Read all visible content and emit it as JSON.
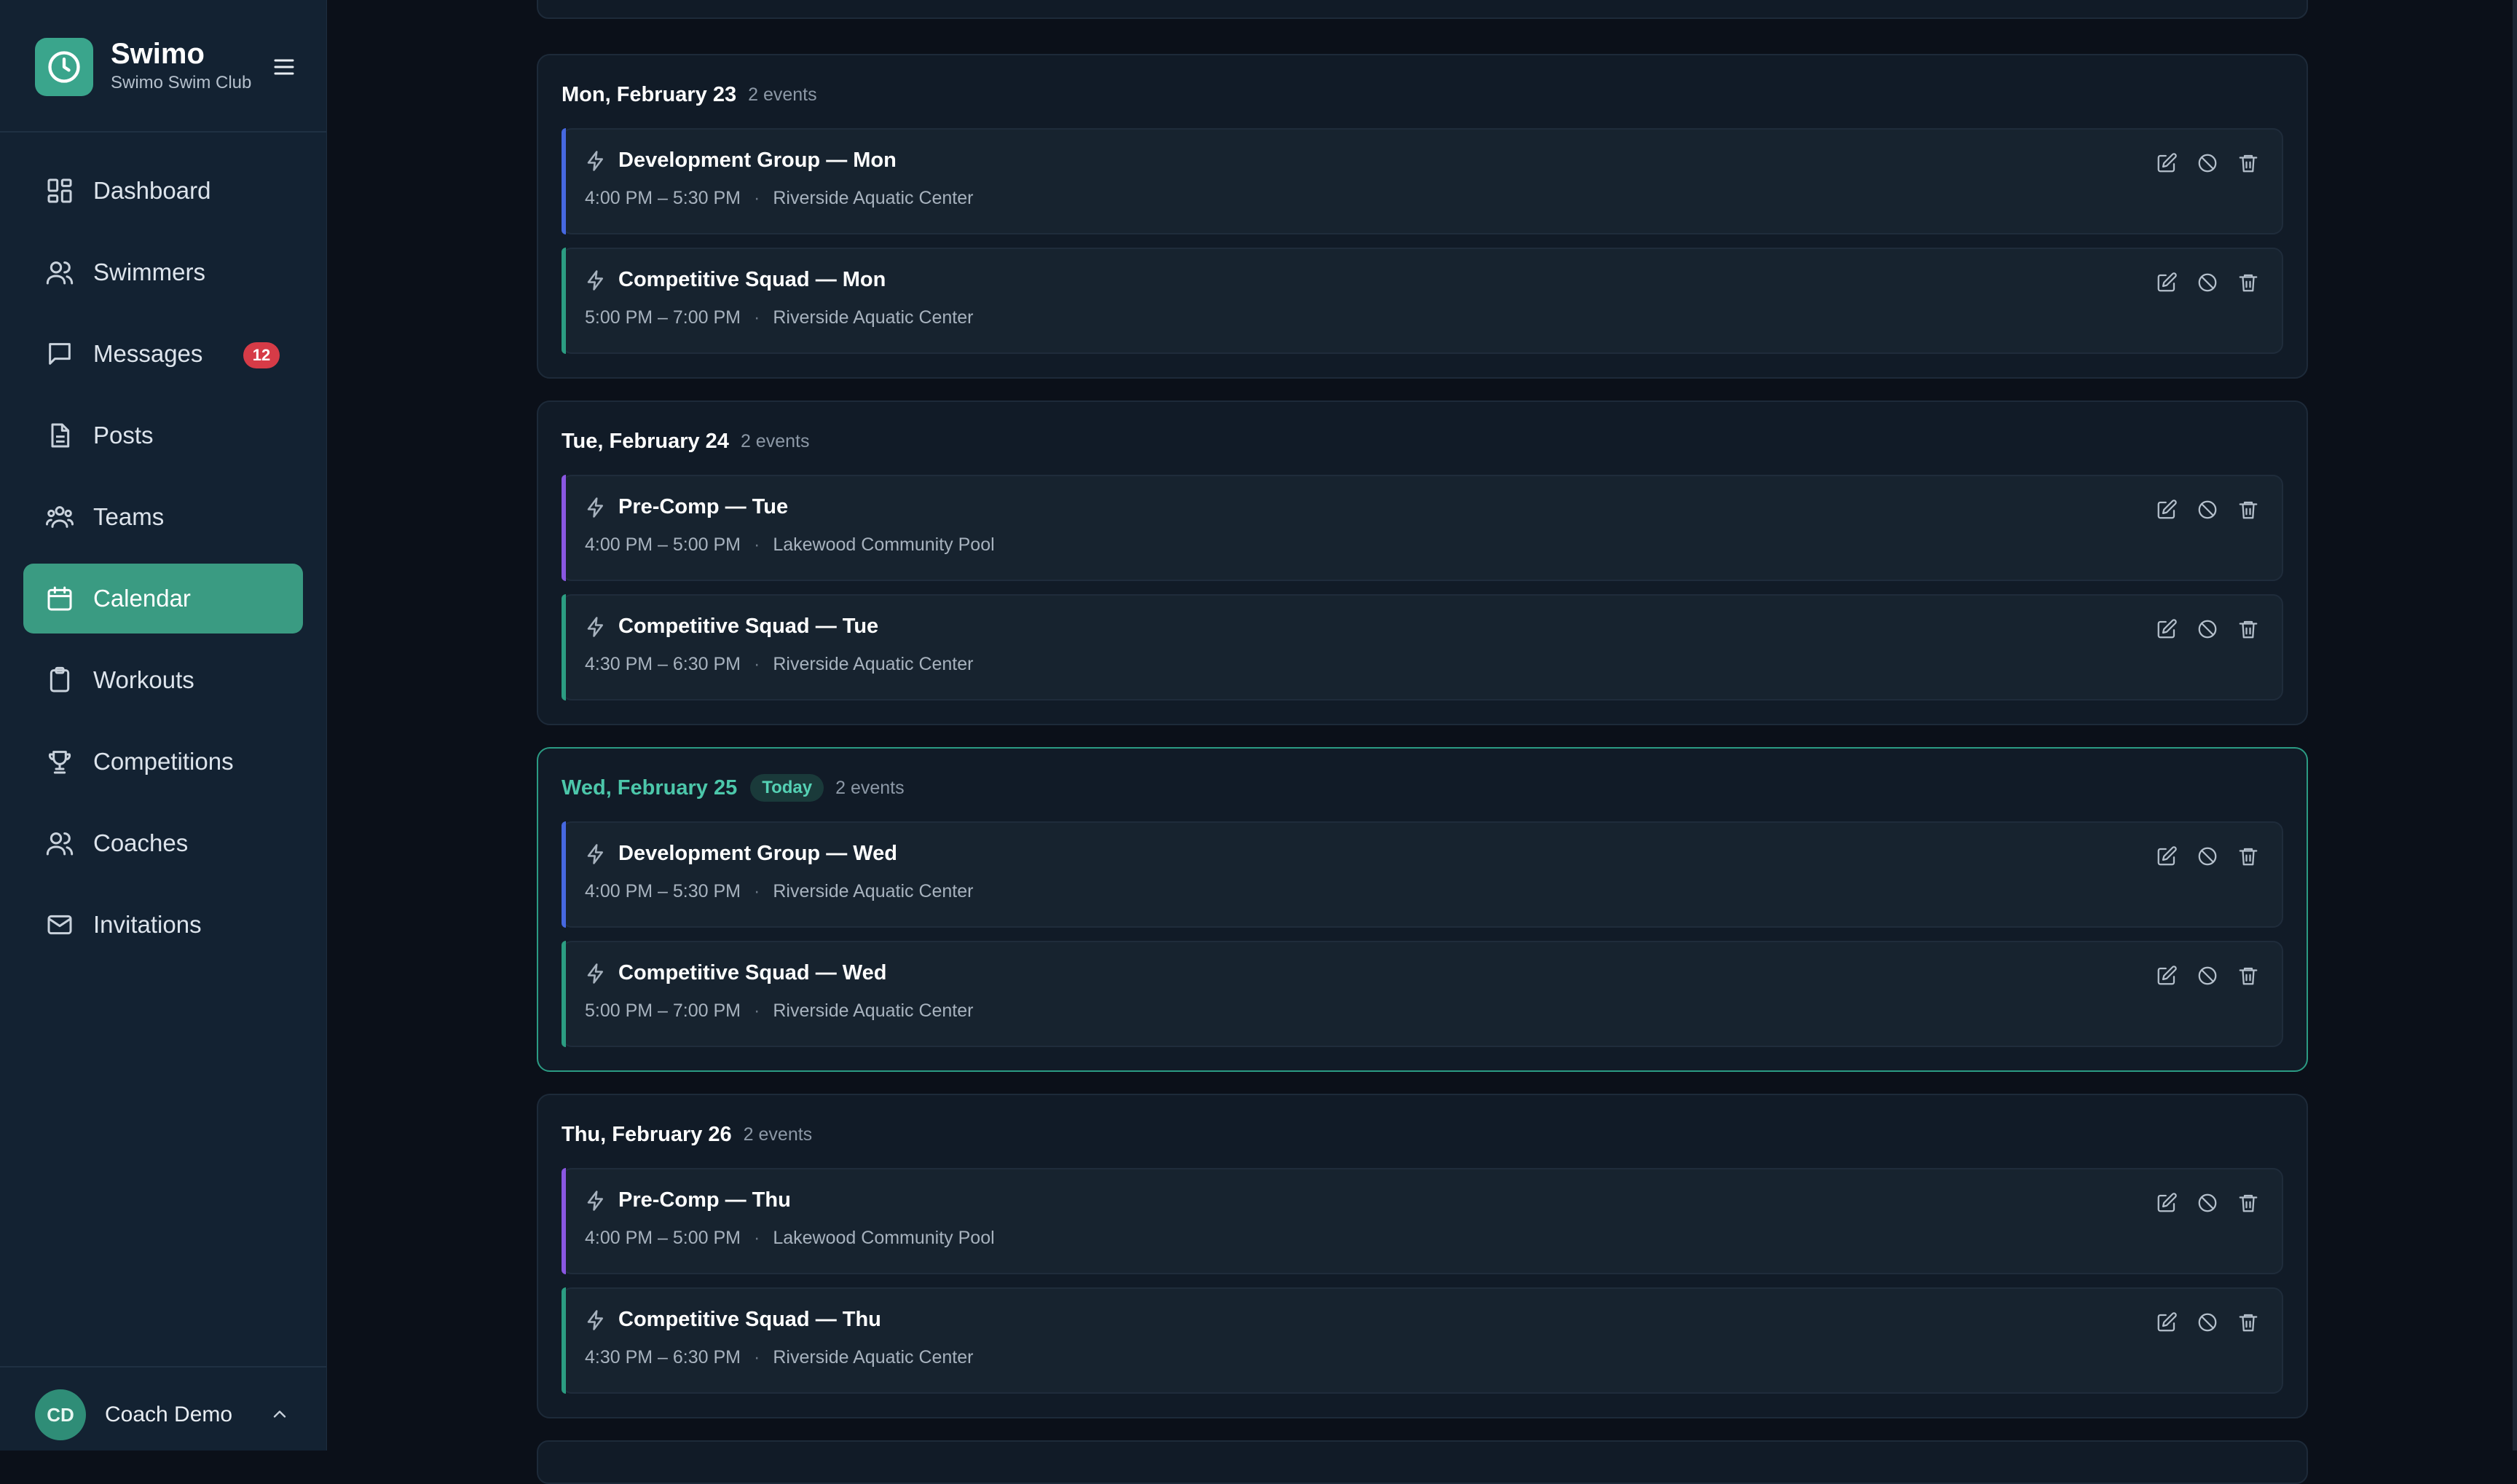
{
  "brand": {
    "title": "Swimo",
    "subtitle": "Swimo Swim Club",
    "logo_icon": "clock-icon",
    "accent": "#3aa58c"
  },
  "nav": [
    {
      "label": "Dashboard",
      "icon": "dashboard-icon",
      "active": false
    },
    {
      "label": "Swimmers",
      "icon": "users-icon",
      "active": false
    },
    {
      "label": "Messages",
      "icon": "message-icon",
      "active": false,
      "badge": "12"
    },
    {
      "label": "Posts",
      "icon": "document-icon",
      "active": false
    },
    {
      "label": "Teams",
      "icon": "team-icon",
      "active": false
    },
    {
      "label": "Calendar",
      "icon": "calendar-icon",
      "active": true
    },
    {
      "label": "Workouts",
      "icon": "clipboard-icon",
      "active": false
    },
    {
      "label": "Competitions",
      "icon": "trophy-icon",
      "active": false
    },
    {
      "label": "Coaches",
      "icon": "users-icon",
      "active": false
    },
    {
      "label": "Invitations",
      "icon": "mail-icon",
      "active": false
    }
  ],
  "user": {
    "initials": "CD",
    "name": "Coach Demo"
  },
  "days": [
    {
      "title": "Mon, February 23",
      "count": "2 events",
      "events": [
        {
          "title": "Development Group — Mon",
          "time": "4:00 PM – 5:30 PM",
          "location": "Riverside Aquatic Center",
          "color": "#4668e0"
        },
        {
          "title": "Competitive Squad — Mon",
          "time": "5:00 PM – 7:00 PM",
          "location": "Riverside Aquatic Center",
          "color": "#2c9d82"
        }
      ]
    },
    {
      "title": "Tue, February 24",
      "count": "2 events",
      "events": [
        {
          "title": "Pre-Comp — Tue",
          "time": "4:00 PM – 5:00 PM",
          "location": "Lakewood Community Pool",
          "color": "#8a57e2"
        },
        {
          "title": "Competitive Squad — Tue",
          "time": "4:30 PM – 6:30 PM",
          "location": "Riverside Aquatic Center",
          "color": "#2c9d82"
        }
      ]
    },
    {
      "title": "Wed, February 25",
      "today_label": "Today",
      "count": "2 events",
      "events": [
        {
          "title": "Development Group — Wed",
          "time": "4:00 PM – 5:30 PM",
          "location": "Riverside Aquatic Center",
          "color": "#4668e0"
        },
        {
          "title": "Competitive Squad — Wed",
          "time": "5:00 PM – 7:00 PM",
          "location": "Riverside Aquatic Center",
          "color": "#2c9d82"
        }
      ]
    },
    {
      "title": "Thu, February 26",
      "count": "2 events",
      "events": [
        {
          "title": "Pre-Comp — Thu",
          "time": "4:00 PM – 5:00 PM",
          "location": "Lakewood Community Pool",
          "color": "#8a57e2"
        },
        {
          "title": "Competitive Squad — Thu",
          "time": "4:30 PM – 6:30 PM",
          "location": "Riverside Aquatic Center",
          "color": "#2c9d82"
        }
      ]
    }
  ],
  "event_actions": [
    "edit-icon",
    "cancel-icon",
    "trash-icon"
  ],
  "meta_separator": "·"
}
